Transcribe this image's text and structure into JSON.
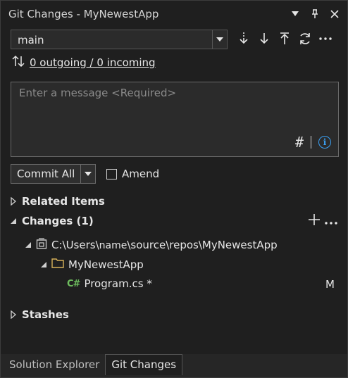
{
  "window": {
    "title": "Git Changes - MyNewestApp"
  },
  "branch": {
    "selected": "main"
  },
  "sync": {
    "status_text": "0 outgoing / 0 incoming"
  },
  "commit_message": {
    "placeholder": "Enter a message <Required>",
    "hash_icon_text": "#"
  },
  "commit": {
    "button_label": "Commit All",
    "amend_label": "Amend"
  },
  "sections": {
    "related_items": "Related Items",
    "changes": "Changes (1)",
    "stashes": "Stashes"
  },
  "tree": {
    "repo_path_prefix": "C:\\Users\\",
    "repo_path_user": "name",
    "repo_path_suffix": "\\source\\repos\\MyNewestApp",
    "project": "MyNewestApp",
    "file_icon": "C#",
    "file": "Program.cs *",
    "file_status": "M"
  },
  "tabs": {
    "solution_explorer": "Solution Explorer",
    "git_changes": "Git Changes"
  },
  "colors": {
    "background": "#1f1f1f",
    "info_accent": "#3aa0f3",
    "folder": "#d8b25a",
    "csharp": "#6fbf5f"
  }
}
